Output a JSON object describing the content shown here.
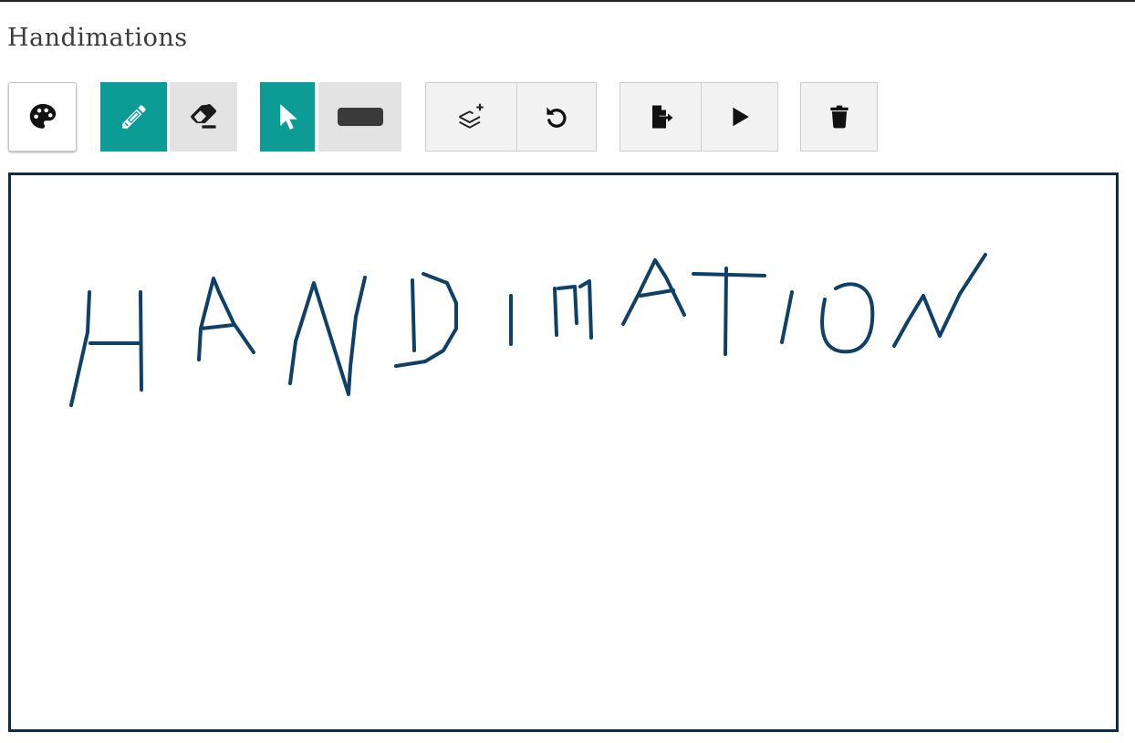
{
  "app": {
    "title": "Handimations"
  },
  "toolbar": {
    "tools": [
      {
        "name": "color-palette-button",
        "icon": "palette-icon"
      },
      {
        "name": "pencil-tool-button",
        "icon": "pencil-icon",
        "active": true
      },
      {
        "name": "eraser-tool-button",
        "icon": "eraser-icon",
        "active": false
      },
      {
        "name": "select-tool-button",
        "icon": "pointer-icon",
        "active": true
      },
      {
        "name": "brush-size-button",
        "icon": "stroke-size-icon",
        "active": false
      },
      {
        "name": "add-layer-button",
        "icon": "layers-plus-icon"
      },
      {
        "name": "undo-button",
        "icon": "undo-icon"
      },
      {
        "name": "export-button",
        "icon": "file-export-icon"
      },
      {
        "name": "play-button",
        "icon": "play-icon"
      },
      {
        "name": "delete-button",
        "icon": "trash-icon"
      }
    ],
    "accent_color": "#0d9b96",
    "inactive_color": "#e3e3e3"
  },
  "canvas": {
    "border_color": "#0f2b4e",
    "stroke_color": "#0e4068",
    "drawing": "handwritten-word-handimation"
  }
}
